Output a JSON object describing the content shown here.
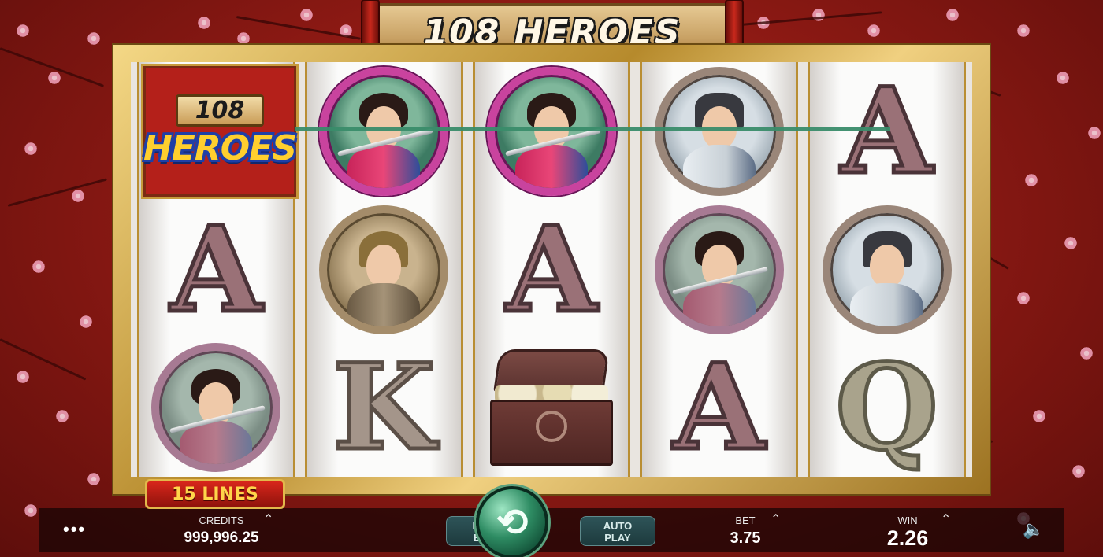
{
  "game": {
    "title": "108 HEROES",
    "logo": {
      "number": "108",
      "word": "HEROES"
    },
    "lines_badge": "15 LINES"
  },
  "reels": [
    [
      {
        "symbol": "logo-wild"
      },
      {
        "symbol": "A"
      },
      {
        "symbol": "warrior-woman",
        "dim": true
      }
    ],
    [
      {
        "symbol": "warrior-woman"
      },
      {
        "symbol": "general"
      },
      {
        "symbol": "K"
      }
    ],
    [
      {
        "symbol": "warrior-woman"
      },
      {
        "symbol": "A"
      },
      {
        "symbol": "treasure-chest"
      }
    ],
    [
      {
        "symbol": "scholar"
      },
      {
        "symbol": "warrior-woman",
        "dim": true
      },
      {
        "symbol": "A"
      }
    ],
    [
      {
        "symbol": "A"
      },
      {
        "symbol": "scholar"
      },
      {
        "symbol": "Q"
      }
    ]
  ],
  "bottom_bar": {
    "menu_icon": "more-dots-icon",
    "credits": {
      "label": "CREDITS",
      "value": "999,996.25"
    },
    "max_bet": {
      "line1": "MAX",
      "line2": "BET"
    },
    "spin_icon": "spin-arrow-icon",
    "auto_play": {
      "line1": "AUTO",
      "line2": "PLAY"
    },
    "bet": {
      "label": "BET",
      "value": "3.75"
    },
    "win": {
      "label": "WIN",
      "value": "2.26"
    },
    "sound_icon": "speaker-icon"
  },
  "colors": {
    "background": "#9b1d16",
    "frame_gold": "#c9a13a",
    "payline": "#3a8c6a",
    "spin_button": "#2e8c63"
  }
}
